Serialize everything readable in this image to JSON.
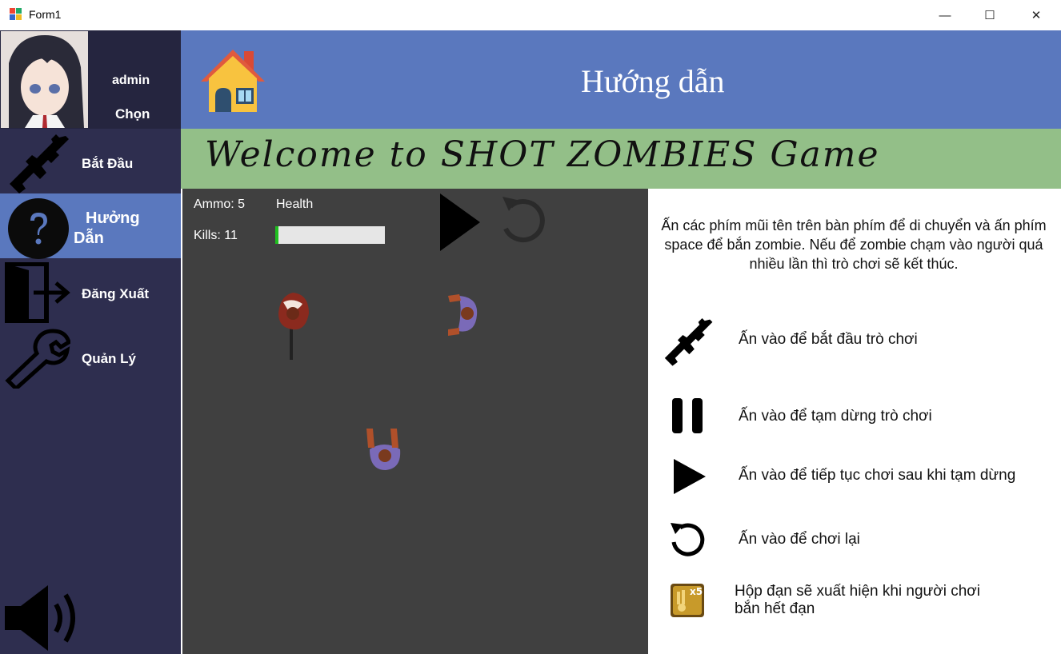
{
  "window": {
    "title": "Form1",
    "minimize_glyph": "—",
    "maximize_glyph": "☐",
    "close_glyph": "✕"
  },
  "sidebar": {
    "username": "admin",
    "choose_label": "Chọn",
    "items": [
      {
        "label": "Bắt Đầu",
        "icon": "rifle-icon"
      },
      {
        "label": "Hưởng\nDẫn",
        "icon": "question-icon"
      },
      {
        "label": "Đăng Xuất",
        "icon": "logout-door-icon"
      },
      {
        "label": "Quản Lý",
        "icon": "wrench-icon"
      }
    ],
    "help_line1": "Hưởng",
    "help_line2": "Dẫn",
    "sound_icon": "speaker-icon"
  },
  "header": {
    "title": "Hướng dẫn",
    "home_icon": "house-icon"
  },
  "banner": {
    "text": "Welcome to SHOT ZOMBIES Game"
  },
  "game": {
    "ammo_label": "Ammo: 5",
    "health_label": "Health",
    "kills_label": "Kills: 11",
    "health_fraction": 0.03,
    "play_icon": "play-icon",
    "restart_icon": "restart-icon"
  },
  "instructions": {
    "intro": "Ấn các phím mũi tên trên bàn phím để di chuyển và ấn phím space để bắn zombie. Nếu để zombie chạm vào người quá nhiều lần thì trò chơi sẽ kết thúc.",
    "rows": [
      {
        "icon": "rifle-icon",
        "text": "Ấn vào để bắt đầu trò chơi"
      },
      {
        "icon": "pause-icon",
        "text": "Ấn vào để tạm dừng trò chơi"
      },
      {
        "icon": "play-icon",
        "text": "Ấn vào để tiếp tục chơi sau khi tạm dừng"
      },
      {
        "icon": "restart-icon",
        "text": "Ấn vào để chơi lại"
      },
      {
        "icon": "ammo-box-icon",
        "text": "Hộp đạn sẽ xuất hiện khi người chơi\nbắn hết đạn"
      }
    ],
    "ammo_box_label": "x5"
  },
  "colors": {
    "sidebar": "#2e2e4f",
    "header": "#5a78be",
    "banner": "#93bf88",
    "game_bg": "#404040",
    "health_fill": "#1fbf1f"
  }
}
